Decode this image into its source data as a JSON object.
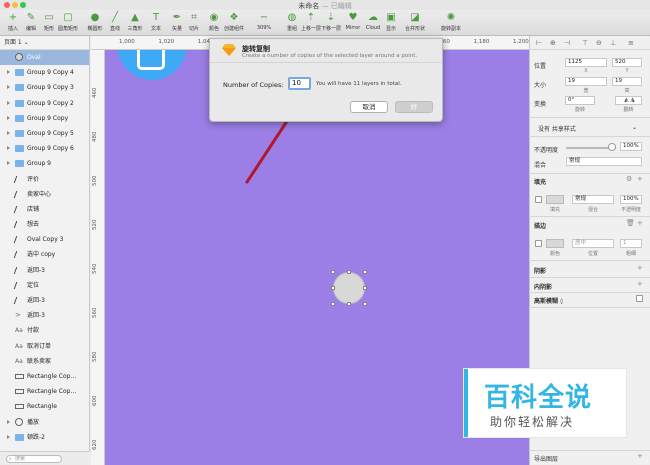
{
  "window": {
    "title": "未命名",
    "subtitle": "— 已编辑"
  },
  "toolbar": {
    "items": [
      {
        "label": "插入",
        "icon": "plus-icon"
      },
      {
        "label": "编辑",
        "icon": "pen-edit-icon"
      },
      {
        "label": "矩形",
        "icon": "rectangle-icon"
      },
      {
        "label": "圆角矩形",
        "icon": "rounded-rect-icon"
      },
      {
        "label": "椭圆形",
        "icon": "ellipse-icon"
      },
      {
        "label": "直线",
        "icon": "line-icon"
      },
      {
        "label": "三角形",
        "icon": "triangle-icon"
      },
      {
        "label": "文本",
        "icon": "text-icon"
      },
      {
        "label": "矢量",
        "icon": "vector-icon"
      },
      {
        "label": "切片",
        "icon": "slice-icon"
      },
      {
        "label": "颜色",
        "icon": "color-wheel-icon"
      },
      {
        "label": "创建组件",
        "icon": "component-icon"
      },
      {
        "label": "309%",
        "icon": "zoom-icon"
      },
      {
        "label": "重组",
        "icon": "regroup-icon"
      },
      {
        "label": "上移一层",
        "icon": "forward-icon"
      },
      {
        "label": "下移一层",
        "icon": "backward-icon"
      },
      {
        "label": "Mirror",
        "icon": "mirror-icon"
      },
      {
        "label": "Cloud",
        "icon": "cloud-icon"
      },
      {
        "label": "显示",
        "icon": "view-icon"
      },
      {
        "label": "合并形状",
        "icon": "combine-icon"
      },
      {
        "label": "旋转副本",
        "icon": "rotate-copies-icon"
      }
    ]
  },
  "layers": {
    "page_label": "页面 1 ⌄",
    "items": [
      {
        "label": "Oval",
        "icon": "oval",
        "selected": true,
        "folder": false
      },
      {
        "label": "Group 9 Copy 4",
        "icon": "folder",
        "selected": false,
        "folder": true
      },
      {
        "label": "Group 9 Copy 3",
        "icon": "folder",
        "selected": false,
        "folder": true
      },
      {
        "label": "Group 9 Copy 2",
        "icon": "folder",
        "selected": false,
        "folder": true
      },
      {
        "label": "Group 9 Copy",
        "icon": "folder",
        "selected": false,
        "folder": true
      },
      {
        "label": "Group 9 Copy 5",
        "icon": "folder",
        "selected": false,
        "folder": true
      },
      {
        "label": "Group 9 Copy 6",
        "icon": "folder",
        "selected": false,
        "folder": true
      },
      {
        "label": "Group 9",
        "icon": "folder",
        "selected": false,
        "folder": true
      },
      {
        "label": "评价",
        "icon": "path",
        "selected": false,
        "folder": false
      },
      {
        "label": "卖家中心",
        "icon": "path",
        "selected": false,
        "folder": false
      },
      {
        "label": "店铺",
        "icon": "path",
        "selected": false,
        "folder": false
      },
      {
        "label": "想去",
        "icon": "path",
        "selected": false,
        "folder": false
      },
      {
        "label": "Oval Copy 3",
        "icon": "path",
        "selected": false,
        "folder": false
      },
      {
        "label": "选中 copy",
        "icon": "path",
        "selected": false,
        "folder": false
      },
      {
        "label": "返回-3",
        "icon": "path",
        "selected": false,
        "folder": false
      },
      {
        "label": "定位",
        "icon": "path",
        "selected": false,
        "folder": false
      },
      {
        "label": "返回-3",
        "icon": "path",
        "selected": false,
        "folder": false
      },
      {
        "label": "返回-3",
        "icon": "chev",
        "selected": false,
        "folder": false
      },
      {
        "label": "付款",
        "icon": "text",
        "selected": false,
        "folder": false
      },
      {
        "label": "取消订单",
        "icon": "text",
        "selected": false,
        "folder": false
      },
      {
        "label": "联系卖家",
        "icon": "text",
        "selected": false,
        "folder": false
      },
      {
        "label": "Rectangle Cop...",
        "icon": "rect",
        "selected": false,
        "folder": false
      },
      {
        "label": "Rectangle Cop...",
        "icon": "rect",
        "selected": false,
        "folder": false
      },
      {
        "label": "Rectangle",
        "icon": "rect",
        "selected": false,
        "folder": false
      },
      {
        "label": "播放",
        "icon": "sym",
        "selected": false,
        "folder": true
      },
      {
        "label": "顿跌-2",
        "icon": "folder",
        "selected": false,
        "folder": true
      }
    ],
    "search_placeholder": "搜索"
  },
  "ruler": {
    "top": [
      "1,000",
      "1,020",
      "1,040",
      "1,060",
      "1,080",
      "1,100",
      "1,120",
      "1,140",
      "1,160",
      "1,180",
      "1,200",
      "1,220"
    ],
    "left": [
      "460",
      "480",
      "500",
      "520",
      "540",
      "560",
      "580",
      "600",
      "620"
    ]
  },
  "dialog": {
    "title": "旋转复制",
    "subtitle": "Create a number of copies of the selected layer around a point.",
    "copies_label": "Number of Copies:",
    "copies_value": "10",
    "hint": "You will have 11 layers in total.",
    "cancel_label": "取消",
    "ok_label": "好"
  },
  "inspector": {
    "position_label": "位置",
    "x_value": "1125",
    "y_value": "520",
    "x_label": "X",
    "y_label": "Y",
    "size_label": "大小",
    "w_value": "19",
    "h_value": "19",
    "w_label": "宽",
    "h_label": "高",
    "transform_label": "变换",
    "rotate_value": "0°",
    "rotate_label": "旋转",
    "flip_label": "翻转",
    "shared_style": "没有 共享样式",
    "opacity_label": "不透明度",
    "opacity_value": "100%",
    "opacity_level": 1.0,
    "blend_label": "混合",
    "blend_value": "常规",
    "fill_label": "填充",
    "fill_mode": "常规",
    "fill_opacity": "100%",
    "fill_sub_fill": "填充",
    "fill_sub_mix": "混合",
    "fill_sub_opacity": "不透明度",
    "border_label": "描边",
    "border_position": "居中",
    "border_width": "1",
    "border_sub_color": "颜色",
    "border_sub_position": "位置",
    "border_sub_width": "粗细",
    "shadow_label": "阴影",
    "inner_shadow_label": "内阴影",
    "blur_label": "高斯模糊 ◊",
    "export_label": "导出图层"
  },
  "watermark": {
    "big": "百科全说",
    "small": "助你轻松解决"
  },
  "colors": {
    "canvas": "#9b7fe6",
    "selection": "#9ab8de",
    "accent": "#33b5e5",
    "arrow": "#b0182c"
  }
}
